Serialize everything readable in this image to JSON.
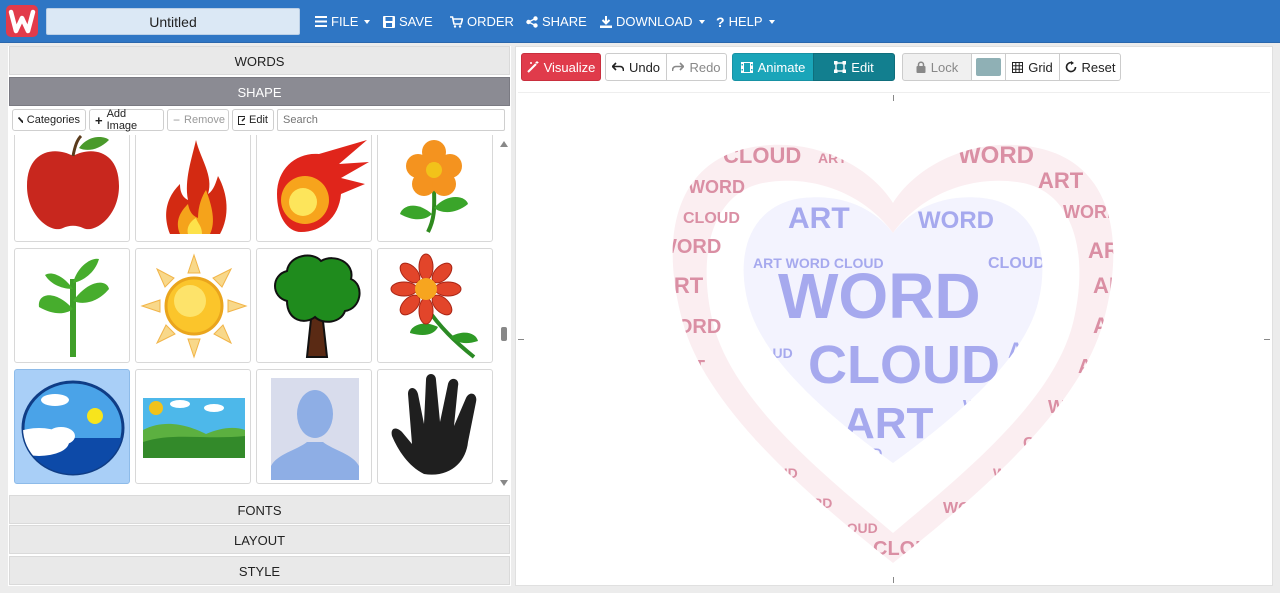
{
  "app": {
    "logo_letter": "W",
    "title_value": "Untitled",
    "brand_color": "#e23b4b",
    "topbar_color": "#2f76c4"
  },
  "menu": [
    {
      "id": "file",
      "label": "FILE",
      "icon": "hamburger-icon",
      "dropdown": true
    },
    {
      "id": "save",
      "label": "SAVE",
      "icon": "save-icon",
      "dropdown": false
    },
    {
      "id": "order",
      "label": "ORDER",
      "icon": "cart-icon",
      "dropdown": false
    },
    {
      "id": "share",
      "label": "SHARE",
      "icon": "share-icon",
      "dropdown": false
    },
    {
      "id": "download",
      "label": "DOWNLOAD",
      "icon": "download-icon",
      "dropdown": true
    },
    {
      "id": "help",
      "label": "HELP",
      "icon": "question-icon",
      "dropdown": true
    }
  ],
  "panels": {
    "words": "WORDS",
    "shape": "SHAPE",
    "fonts": "FONTS",
    "layout": "LAYOUT",
    "style": "STYLE"
  },
  "shape_toolbar": {
    "categories": "Categories",
    "add_image": "Add Image",
    "remove": "Remove",
    "edit": "Edit",
    "search_placeholder": "Search"
  },
  "shapes": [
    {
      "name": "apple",
      "selected": false
    },
    {
      "name": "fire",
      "selected": false
    },
    {
      "name": "fireball",
      "selected": false
    },
    {
      "name": "flower",
      "selected": false
    },
    {
      "name": "plant",
      "selected": false
    },
    {
      "name": "sun",
      "selected": false
    },
    {
      "name": "tree",
      "selected": false
    },
    {
      "name": "red-flower",
      "selected": false
    },
    {
      "name": "globe",
      "selected": true
    },
    {
      "name": "landscape",
      "selected": false
    },
    {
      "name": "person-silhouette",
      "selected": false
    },
    {
      "name": "hand",
      "selected": false
    }
  ],
  "toolbar": {
    "visualize": "Visualize",
    "undo": "Undo",
    "redo": "Redo",
    "animate": "Animate",
    "edit": "Edit",
    "lock": "Lock",
    "grid": "Grid",
    "reset": "Reset",
    "swatch_color": "#8fb0b5"
  },
  "wordcloud": {
    "words": [
      "WORD",
      "CLOUD",
      "ART"
    ],
    "outer_color": "#d98aa0",
    "inner_color": "#a6a9ee"
  }
}
